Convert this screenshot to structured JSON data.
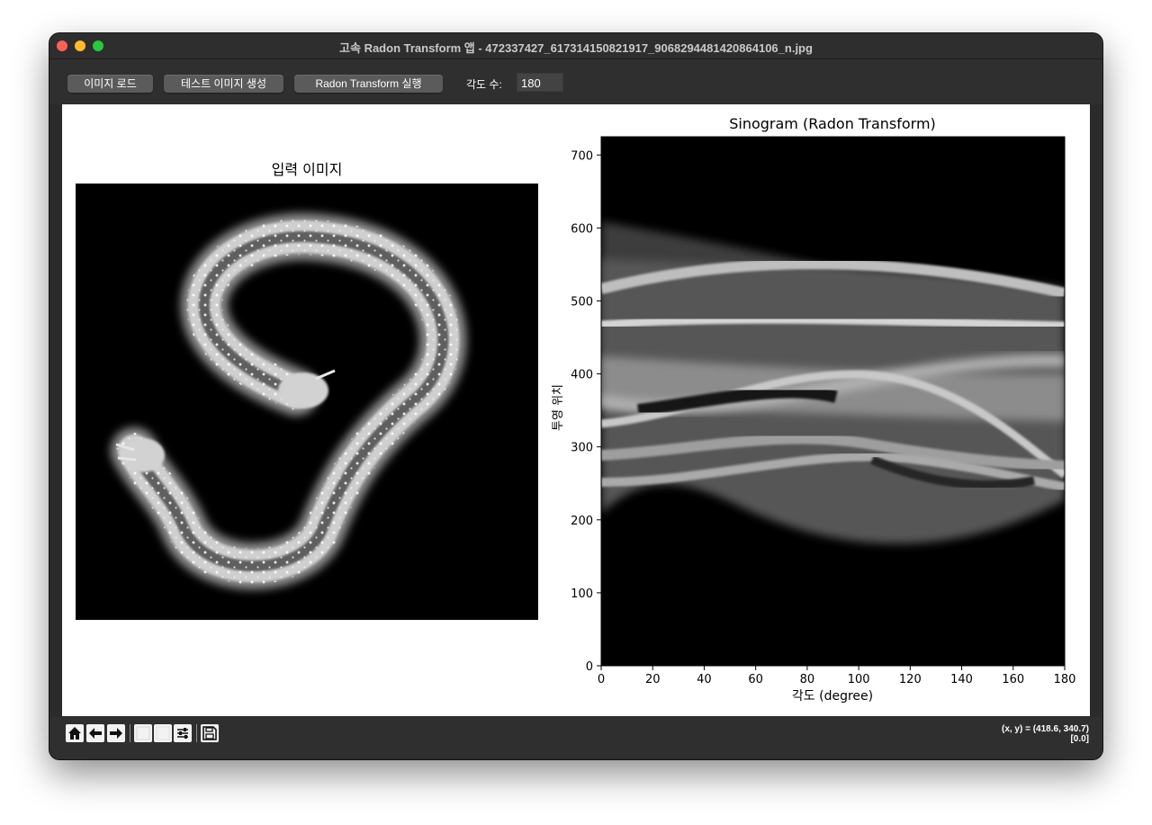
{
  "window": {
    "title": "고속 Radon Transform 앱 - 472337427_617314150821917_9068294481420864106_n.jpg"
  },
  "toolbar": {
    "load_label": "이미지 로드",
    "test_label": "테스트 이미지 생성",
    "run_label": "Radon Transform 실행",
    "angles_label": "각도 수:",
    "angles_value": "180"
  },
  "left_panel": {
    "title": "입력 이미지"
  },
  "chart_data": {
    "type": "heatmap",
    "title": "Sinogram (Radon Transform)",
    "xlabel": "각도 (degree)",
    "ylabel": "투영 위치",
    "xlim": [
      0,
      180
    ],
    "ylim": [
      0,
      725
    ],
    "x_ticks": [
      0,
      20,
      40,
      60,
      80,
      100,
      120,
      140,
      160,
      180
    ],
    "y_ticks": [
      0,
      100,
      200,
      300,
      400,
      500,
      600,
      700
    ],
    "colormap": "gray",
    "grid": false
  },
  "nav": {
    "coords": "(x, y) = (418.6, 340.7)",
    "value": "[0.0]",
    "icons": [
      "home-icon",
      "back-arrow-icon",
      "forward-arrow-icon",
      "pan-icon",
      "zoom-icon",
      "configure-subplots-icon",
      "save-icon"
    ]
  },
  "colors": {
    "window_bg": "#2b2b2b",
    "button_bg": "#5b5b5b",
    "canvas_bg": "#ffffff",
    "close": "#fe5f57",
    "minimize": "#febc2e",
    "maximize": "#28c840"
  }
}
